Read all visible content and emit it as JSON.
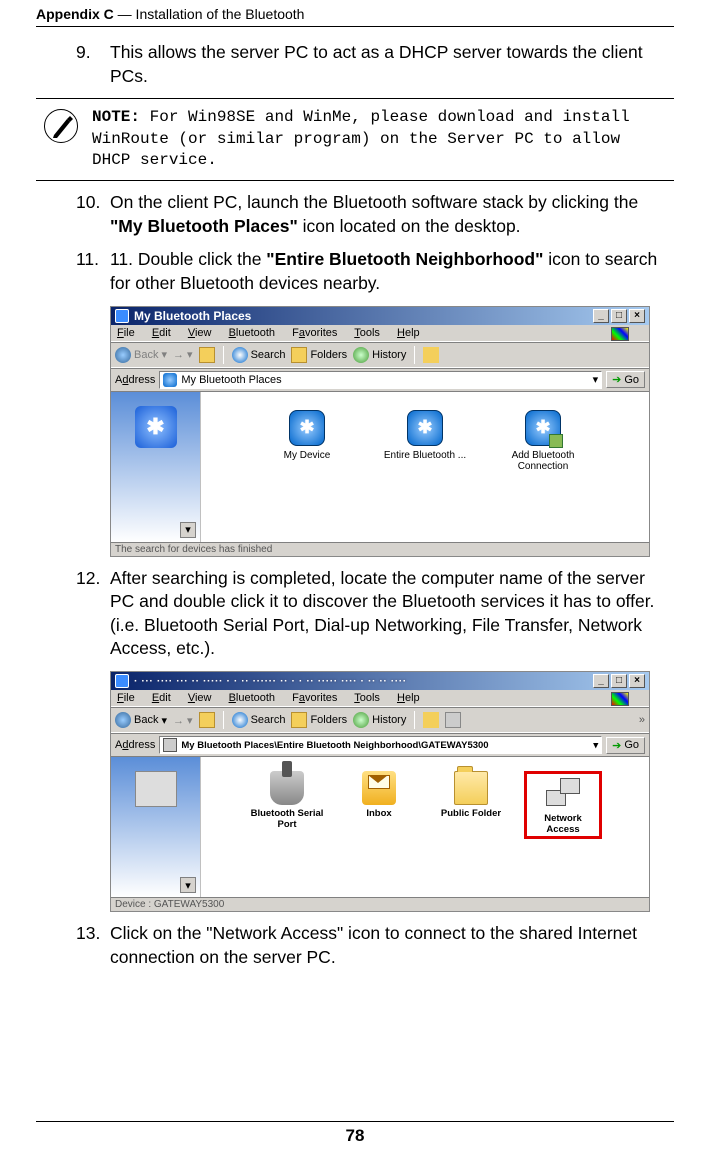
{
  "header": {
    "left": "Appendix C",
    "right": " — Installation of the Bluetooth"
  },
  "steps": {
    "s9": {
      "num": "9.",
      "text": "This allows the server PC to act as a DHCP server towards the client PCs."
    },
    "s10": {
      "num": "10.",
      "pre": "On the client PC, launch the Bluetooth software stack by clicking the ",
      "bold": "\"My Bluetooth Places\"",
      "post": " icon located on the desktop."
    },
    "s11": {
      "num": "11.",
      "pre": "11. Double click the ",
      "bold": "\"Entire Bluetooth Neighborhood\"",
      "post": " icon to search for other Bluetooth devices nearby."
    },
    "s12": {
      "num": "12.",
      "text": "After searching is completed, locate the computer name of the server PC and double click it to discover the Bluetooth services it has to offer. (i.e. Bluetooth Serial Port, Dial-up Networking, File Transfer, Network Access, etc.)."
    },
    "s13": {
      "num": "13.",
      "text": "Click on the \"Network Access\" icon to connect to the shared Internet connection on the server PC."
    }
  },
  "note": {
    "label": "NOTE:",
    "body": " For Win98SE and WinMe, please download and install WinRoute (or similar program) on the Server PC to allow DHCP service."
  },
  "win1": {
    "title": "My Bluetooth Places",
    "menus": {
      "file": "File",
      "edit": "Edit",
      "view": "View",
      "bluetooth": "Bluetooth",
      "favorites": "Favorites",
      "tools": "Tools",
      "help": "Help"
    },
    "toolbar": {
      "back": "Back",
      "search": "Search",
      "folders": "Folders",
      "history": "History"
    },
    "address_label": "Address",
    "address_value": "My Bluetooth Places",
    "go": "Go",
    "icons": {
      "mydevice": "My Device",
      "entire": "Entire Bluetooth ...",
      "add": "Add Bluetooth Connection"
    },
    "status": "The search for devices has finished"
  },
  "win2": {
    "title": "My Bluetooth Places\\Entire Bluetooth Neighborhood\\GATEWAY5300",
    "titlebar_garble": "· ··· ···· ··· ·· ····· · · ·· ······ ·· ·  · ·· ····· ···· · ·· ·· ····",
    "menus": {
      "file": "File",
      "edit": "Edit",
      "view": "View",
      "bluetooth": "Bluetooth",
      "favorites": "Favorites",
      "tools": "Tools",
      "help": "Help"
    },
    "toolbar": {
      "back": "Back",
      "search": "Search",
      "folders": "Folders",
      "history": "History"
    },
    "address_label": "Address",
    "address_value": "My Bluetooth Places\\Entire Bluetooth Neighborhood\\GATEWAY5300",
    "go": "Go",
    "icons": {
      "serial": "Bluetooth Serial Port",
      "inbox": "Inbox",
      "public": "Public Folder",
      "net": "Network Access"
    },
    "status": "Device : GATEWAY5300"
  },
  "page_number": "78"
}
